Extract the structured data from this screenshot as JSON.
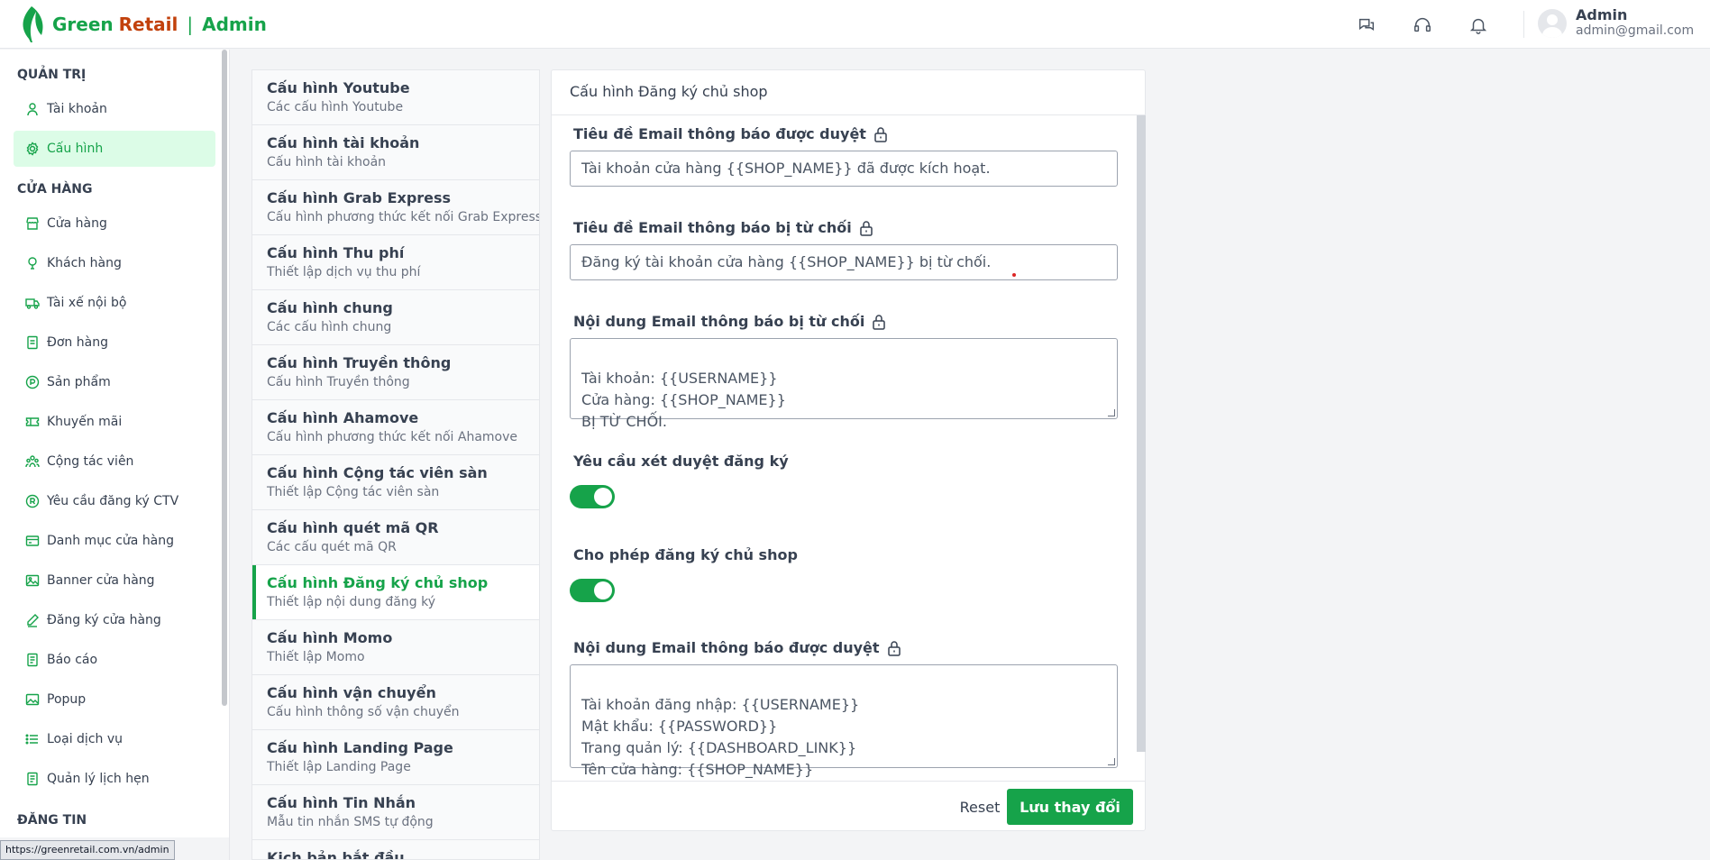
{
  "header": {
    "brand_green": "Green",
    "brand_red": "Retail",
    "brand_sep": "|",
    "brand_admin": "Admin",
    "icons": [
      "chat-icon",
      "headset-icon",
      "bell-icon"
    ],
    "user_name": "Admin",
    "user_email": "admin@gmail.com"
  },
  "sidebar": {
    "section_admin": "QUẢN TRỊ",
    "section_store": "CỬA HÀNG",
    "section_post": "ĐĂNG TIN",
    "admin_items": [
      {
        "label": "Tài khoản",
        "icon": "user-icon"
      },
      {
        "label": "Cấu hình",
        "icon": "gear-icon",
        "active": true
      }
    ],
    "store_items": [
      {
        "label": "Cửa hàng",
        "icon": "store-icon"
      },
      {
        "label": "Khách hàng",
        "icon": "customer-icon"
      },
      {
        "label": "Tài xế nội bộ",
        "icon": "truck-icon"
      },
      {
        "label": "Đơn hàng",
        "icon": "order-icon"
      },
      {
        "label": "Sản phẩm",
        "icon": "product-icon"
      },
      {
        "label": "Khuyến mãi",
        "icon": "ticket-icon"
      },
      {
        "label": "Cộng tác viên",
        "icon": "team-icon"
      },
      {
        "label": "Yêu cầu đăng ký CTV",
        "icon": "registered-icon"
      },
      {
        "label": "Danh mục cửa hàng",
        "icon": "card-icon"
      },
      {
        "label": "Banner cửa hàng",
        "icon": "image-icon"
      },
      {
        "label": "Đăng ký cửa hàng",
        "icon": "pencil-icon"
      },
      {
        "label": "Báo cáo",
        "icon": "report-icon"
      },
      {
        "label": "Popup",
        "icon": "popup-icon"
      },
      {
        "label": "Loại dịch vụ",
        "icon": "list-icon"
      },
      {
        "label": "Quản lý lịch hẹn",
        "icon": "calendar-icon"
      }
    ],
    "status_url": "https://greenretail.com.vn/admin"
  },
  "settings_list": [
    {
      "title": "Cấu hình Youtube",
      "sub": "Các cấu hình Youtube"
    },
    {
      "title": "Cấu hình tài khoản",
      "sub": "Cấu hình tài khoản"
    },
    {
      "title": "Cấu hình Grab Express",
      "sub": "Cấu hình phương thức kết nối Grab Express"
    },
    {
      "title": "Cấu hình Thu phí",
      "sub": "Thiết lập dịch vụ thu phí"
    },
    {
      "title": "Cấu hình chung",
      "sub": "Các cấu hình chung"
    },
    {
      "title": "Cấu hình Truyền thông",
      "sub": "Cấu hình Truyền thông"
    },
    {
      "title": "Cấu hình Ahamove",
      "sub": "Cấu hình phương thức kết nối Ahamove"
    },
    {
      "title": "Cấu hình Cộng tác viên sàn",
      "sub": "Thiết lập Cộng tác viên sàn"
    },
    {
      "title": "Cấu hình quét mã QR",
      "sub": "Các cấu quét mã QR"
    },
    {
      "title": "Cấu hình Đăng ký chủ shop",
      "sub": "Thiết lập nội dung đăng ký",
      "active": true
    },
    {
      "title": "Cấu hình Momo",
      "sub": "Thiết lập Momo"
    },
    {
      "title": "Cấu hình vận chuyển",
      "sub": "Cấu hình thông số vận chuyển"
    },
    {
      "title": "Cấu hình Landing Page",
      "sub": "Thiết lập Landing Page"
    },
    {
      "title": "Cấu hình Tin Nhắn",
      "sub": "Mẫu tin nhắn SMS tự động"
    },
    {
      "title": "Kịch bản bắt đầu",
      "sub": ""
    }
  ],
  "panel": {
    "title": "Cấu hình Đăng ký chủ shop",
    "approved_subject_label": "Tiêu đề Email thông báo được duyệt",
    "approved_subject_value": "Tài khoản cửa hàng {{SHOP_NAME}} đã được kích hoạt.",
    "rejected_subject_label": "Tiêu đề Email thông báo bị từ chối",
    "rejected_subject_value": "Đăng ký tài khoản cửa hàng {{SHOP_NAME}} bị từ chối.",
    "rejected_body_label": "Nội dung Email thông báo bị từ chối",
    "rejected_body_value": "Tài khoản: {{USERNAME}}\nCửa hàng: {{SHOP_NAME}}\nBỊ TỪ CHỐI.",
    "require_review_label": "Yêu cầu xét duyệt đăng ký",
    "require_review_on": true,
    "allow_register_label": "Cho phép đăng ký chủ shop",
    "allow_register_on": true,
    "approved_body_label": "Nội dung Email thông báo được duyệt",
    "approved_body_value": "Tài khoản đăng nhập: {{USERNAME}}\nMật khẩu: {{PASSWORD}}\nTrang quản lý: {{DASHBOARD_LINK}}\nTên cửa hàng: {{SHOP_NAME}}",
    "reset_label": "Reset",
    "save_label": "Lưu thay đổi"
  },
  "colors": {
    "accent": "#16a34a",
    "brand_red": "#c2410c"
  }
}
